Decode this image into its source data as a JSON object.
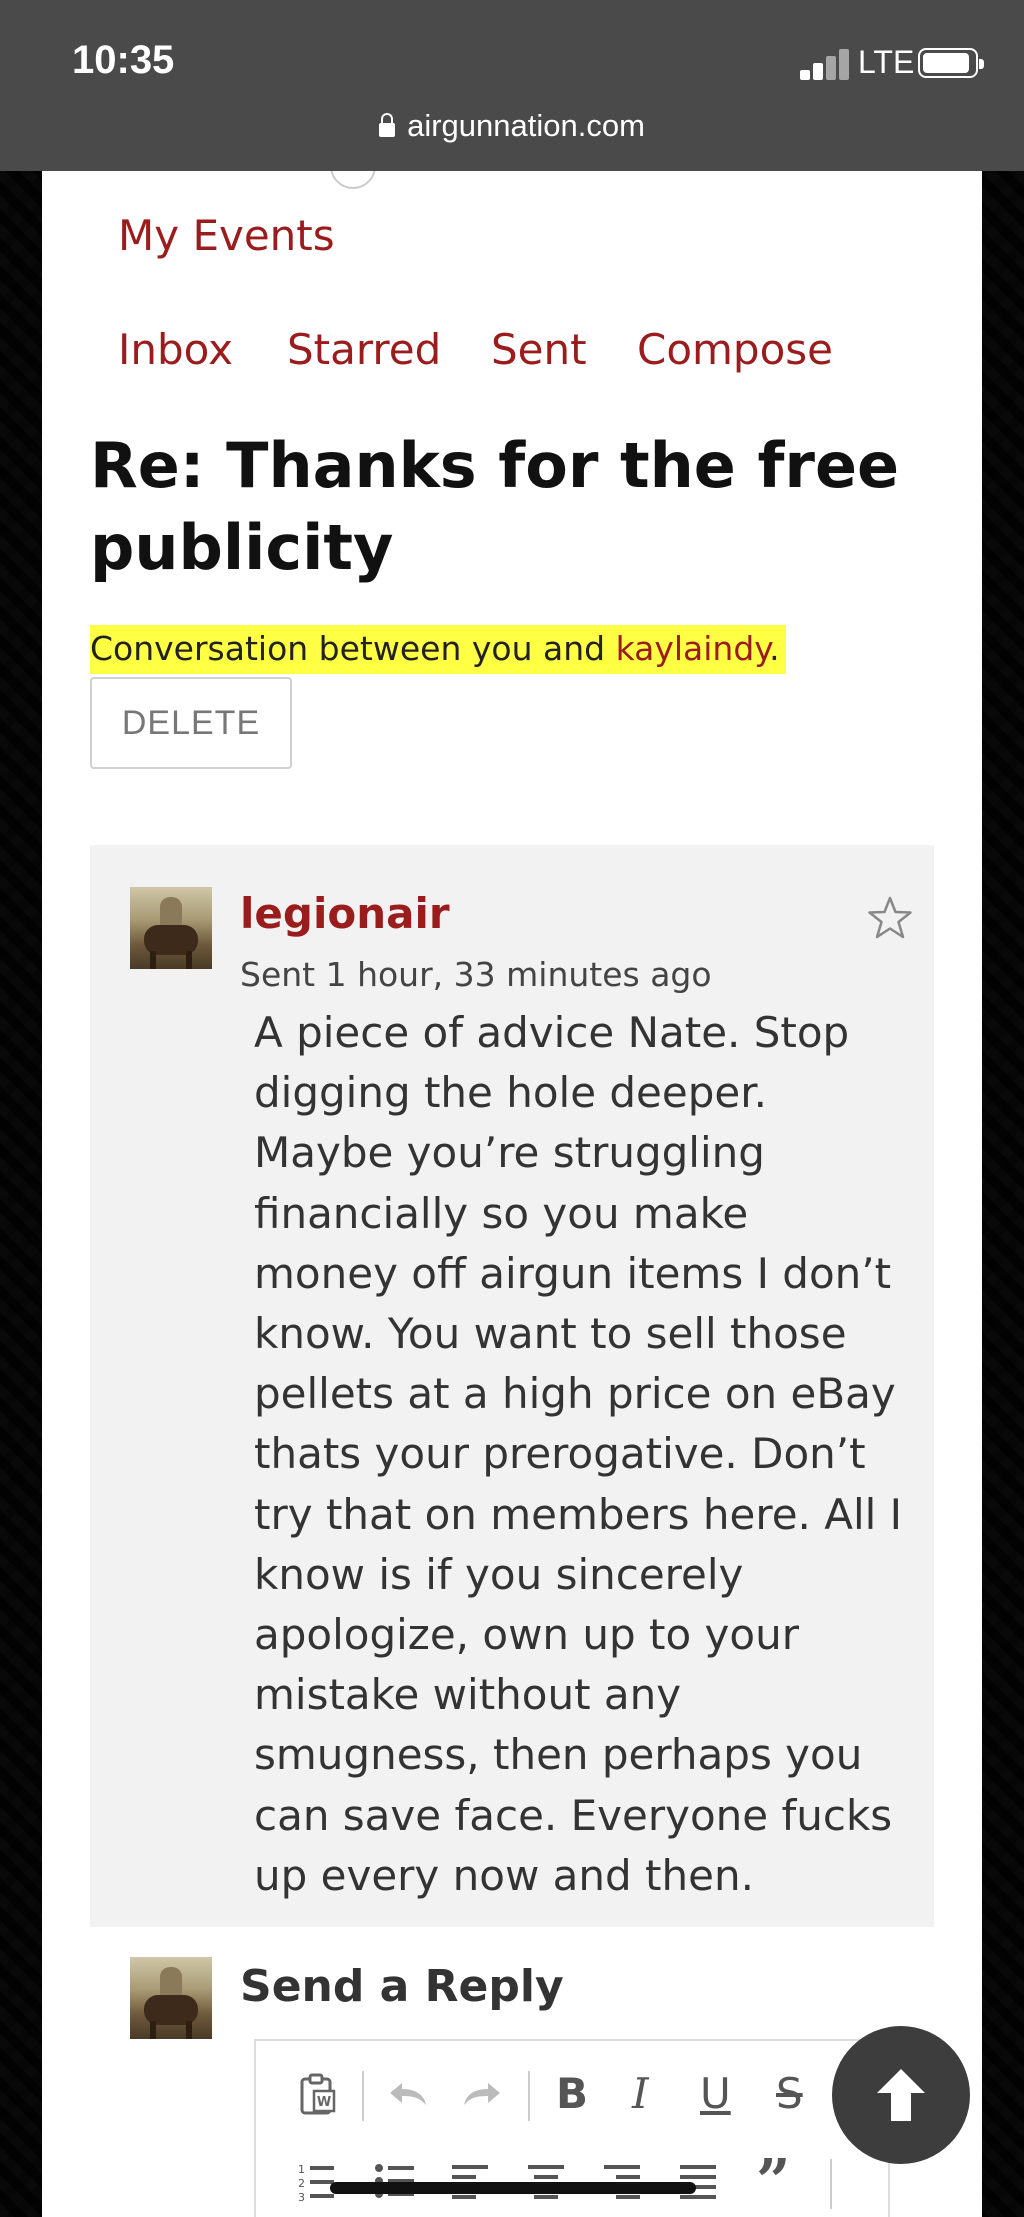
{
  "status_bar": {
    "time": "10:35",
    "network": "LTE",
    "url": "airgunnation.com"
  },
  "nav": {
    "my_events": "My Events",
    "tabs": [
      "Inbox",
      "Starred",
      "Sent",
      "Compose"
    ]
  },
  "conversation": {
    "title": "Re: Thanks for the free publicity",
    "between_prefix": "Conversation between you and ",
    "other_user": "kaylaindy",
    "between_suffix": ".",
    "delete_label": "DELETE"
  },
  "message": {
    "sender": "legionair",
    "sent_time": "Sent 1 hour, 33 minutes ago",
    "body": "A piece of advice Nate. Stop digging the hole deeper. Maybe you’re struggling financially so you make money off airgun items I don’t know. You want to sell those pellets at a high price on eBay thats your prerogative. Don’t try that on members here. All I know is if you sincerely apologize, own up to your mistake without any smugness, then perhaps you can save face. Everyone fucks up every now and then."
  },
  "reply": {
    "title": "Send a Reply",
    "toolbar_row1": [
      "paste-word-icon",
      "undo-icon",
      "redo-icon",
      "bold-icon",
      "italic-icon",
      "underline-icon",
      "strikethrough-icon"
    ],
    "toolbar_row2": [
      "ordered-list-icon",
      "unordered-list-icon",
      "align-left-icon",
      "align-center-icon",
      "align-right-icon",
      "align-justify-icon",
      "blockquote-icon"
    ],
    "bold_glyph": "B",
    "italic_glyph": "I",
    "underline_glyph": "U",
    "strike_glyph": "S",
    "quote_glyph": "”"
  },
  "colors": {
    "accent": "#9b1c1c",
    "highlight": "#ffff44",
    "message_bg": "#f2f2f2",
    "top_bar": "#4a4a4a"
  }
}
